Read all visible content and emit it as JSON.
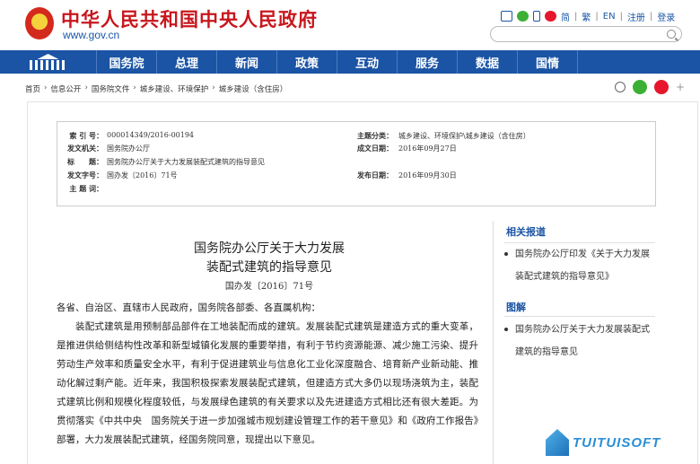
{
  "header": {
    "title": "中华人民共和国中央人民政府",
    "url": "www.gov.cn",
    "links": [
      "简",
      "繁",
      "EN",
      "注册",
      "登录"
    ]
  },
  "nav": {
    "items": [
      "国务院",
      "总理",
      "新闻",
      "政策",
      "互动",
      "服务",
      "数据",
      "国情"
    ]
  },
  "breadcrumb": [
    "首页",
    "信息公开",
    "国务院文件",
    "城乡建设、环境保护",
    "城乡建设（含住房）"
  ],
  "info": {
    "index_label": "索 引 号：",
    "index_value": "000014349/2016-00194",
    "topic_label": "主题分类：",
    "topic_value": "城乡建设、环境保护\\城乡建设（含住房）",
    "issuer_label": "发文机关：",
    "issuer_value": "国务院办公厅",
    "created_label": "成文日期：",
    "created_value": "2016年09月27日",
    "title_label": "标　　题：",
    "title_value": "国务院办公厅关于大力发展装配式建筑的指导意见",
    "docno_label": "发文字号：",
    "docno_value": "国办发〔2016〕71号",
    "published_label": "发布日期：",
    "published_value": "2016年09月30日",
    "keywords_label": "主 题 词："
  },
  "article": {
    "title_line1": "国务院办公厅关于大力发展",
    "title_line2": "装配式建筑的指导意见",
    "docno": "国办发〔2016〕71号",
    "salutation": "各省、自治区、直辖市人民政府，国务院各部委、各直属机构：",
    "paragraph": "装配式建筑是用预制部品部件在工地装配而成的建筑。发展装配式建筑是建造方式的重大变革，是推进供给侧结构性改革和新型城镇化发展的重要举措，有利于节约资源能源、减少施工污染、提升劳动生产效率和质量安全水平，有利于促进建筑业与信息化工业化深度融合、培育新产业新动能、推动化解过剩产能。近年来，我国积极探索发展装配式建筑，但建造方式大多仍以现场浇筑为主，装配式建筑比例和规模化程度较低，与发展绿色建筑的有关要求以及先进建造方式相比还有很大差距。为贯彻落实《中共中央　国务院关于进一步加强城市规划建设管理工作的若干意见》和《政府工作报告》部署，大力发展装配式建筑，经国务院同意，现提出以下意见。"
  },
  "sidebar": {
    "related_title": "相关报道",
    "related_item": "国务院办公厅印发《关于大力发展装配式建筑的指导意见》",
    "graphic_title": "图解",
    "graphic_item": "国务院办公厅关于大力发展装配式建筑的指导意见"
  },
  "watermark": "TUITUISOFT"
}
